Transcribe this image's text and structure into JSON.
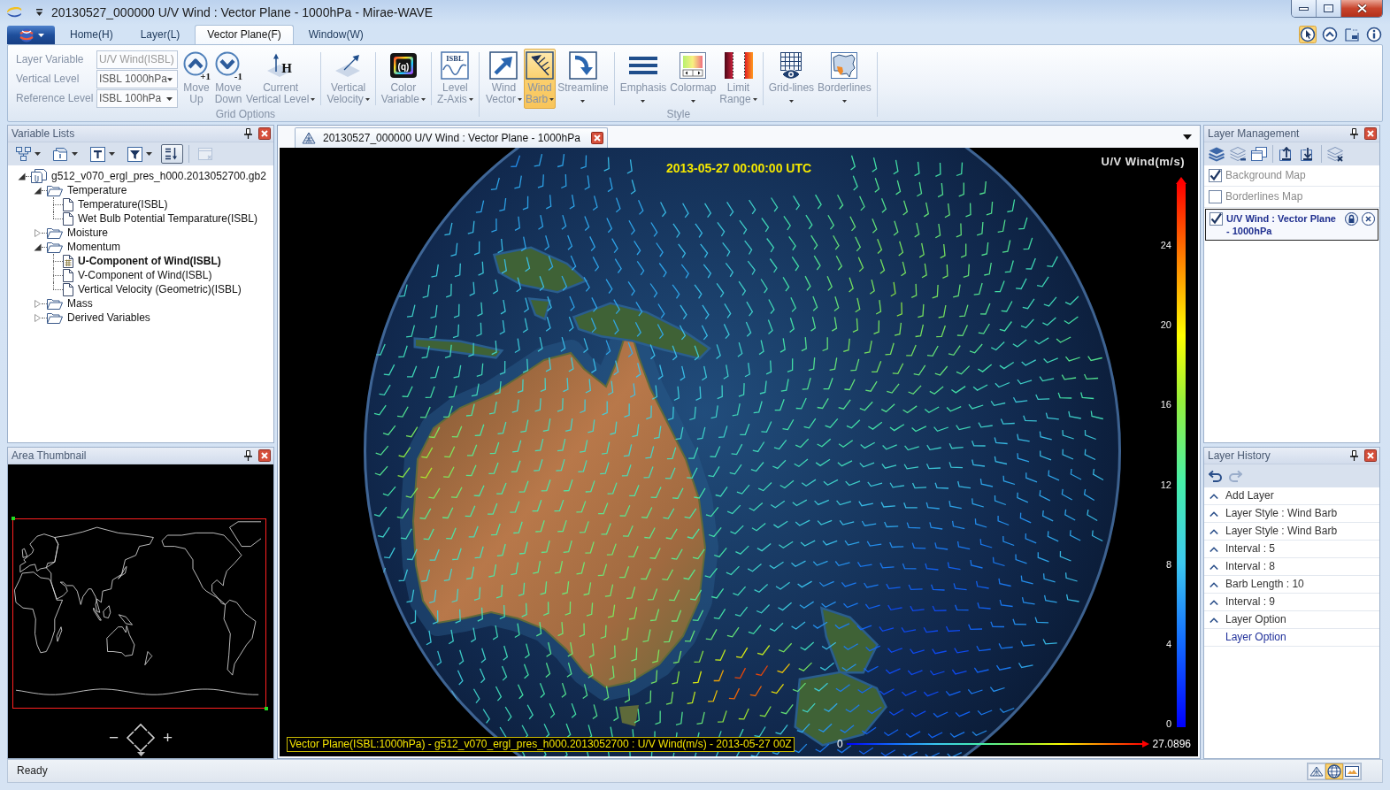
{
  "window": {
    "title": "20130527_000000 U/V Wind : Vector Plane - 1000hPa - Mirae-WAVE"
  },
  "ribbon": {
    "tabs": [
      {
        "label": "Home(H)",
        "selected": false
      },
      {
        "label": "Layer(L)",
        "selected": false
      },
      {
        "label": "Vector Plane(F)",
        "selected": true
      },
      {
        "label": "Window(W)",
        "selected": false
      }
    ],
    "quick_tools": [
      {
        "selected": true
      },
      {
        "selected": false
      },
      {
        "selected": false
      },
      {
        "selected": false
      }
    ],
    "groups": [
      {
        "label": "Grid Options",
        "fields": [
          {
            "label": "Layer Variable",
            "value": "U/V Wind(ISBL)",
            "disabled": true
          },
          {
            "label": "Vertical Level",
            "value": "ISBL 1000hPa",
            "disabled": false
          },
          {
            "label": "Reference Level",
            "value": "ISBL 100hPa",
            "disabled": false
          }
        ],
        "sections": [
          [
            {
              "label": "Move Up",
              "icon_text": "+1",
              "dropdown": false,
              "selected": false
            },
            {
              "label": "Move Down",
              "icon_text": "-1",
              "dropdown": false,
              "selected": false
            },
            {
              "label": "Current Vertical Level",
              "icon_text": "H",
              "dropdown": true,
              "selected": false
            }
          ],
          [
            {
              "label": "Vertical Velocity",
              "dropdown": true,
              "selected": false
            }
          ],
          [
            {
              "label": "Color Variable",
              "icon_text": "(q)",
              "dropdown": true,
              "selected": false
            }
          ],
          [
            {
              "label": "Level Z-Axis",
              "icon_text": "ISBL",
              "dropdown": true,
              "selected": false
            }
          ]
        ]
      },
      {
        "label": "Style",
        "sections": [
          [
            {
              "label": "Wind Vector",
              "dropdown": true,
              "selected": false
            },
            {
              "label": "Wind Barb",
              "dropdown": true,
              "selected": true
            },
            {
              "label": "Streamline",
              "dropdown": true,
              "selected": false
            }
          ],
          [
            {
              "label": "Emphasis",
              "dropdown": true,
              "selected": false
            },
            {
              "label": "Colormap",
              "dropdown": true,
              "selected": false
            },
            {
              "label": "Limit Range",
              "dropdown": true,
              "selected": false
            }
          ],
          [
            {
              "label": "Grid-lines",
              "dropdown": true,
              "selected": false
            },
            {
              "label": "Borderlines",
              "dropdown": true,
              "selected": false
            }
          ]
        ]
      }
    ]
  },
  "variable_lists": {
    "title": "Variable Lists",
    "toolbar": [
      {
        "dropdown": true,
        "selected": false,
        "disabled": false
      },
      {
        "dropdown": true,
        "selected": false,
        "disabled": false
      },
      {
        "dropdown": true,
        "selected": false,
        "disabled": false
      },
      {
        "dropdown": true,
        "selected": false,
        "disabled": false
      },
      {
        "dropdown": false,
        "selected": true,
        "disabled": false
      },
      {
        "dropdown": false,
        "selected": false,
        "disabled": true
      }
    ],
    "tree": [
      {
        "label": "g512_v070_ergl_pres_h000.2013052700.gb2",
        "kind": "file",
        "expanded": true,
        "selected": false,
        "children": [
          {
            "label": "Temperature",
            "kind": "folder",
            "expanded": true,
            "selected": false,
            "children": [
              {
                "label": "Temperature(ISBL)",
                "kind": "variable",
                "selected": false
              },
              {
                "label": "Wet Bulb Potential Temparature(ISBL)",
                "kind": "variable",
                "selected": false
              }
            ]
          },
          {
            "label": "Moisture",
            "kind": "folder",
            "expanded": false,
            "selected": false
          },
          {
            "label": "Momentum",
            "kind": "folder",
            "expanded": true,
            "selected": false,
            "children": [
              {
                "label": "U-Component of Wind(ISBL)",
                "kind": "variable",
                "selected": true
              },
              {
                "label": "V-Component of Wind(ISBL)",
                "kind": "variable",
                "selected": false
              },
              {
                "label": "Vertical Velocity (Geometric)(ISBL)",
                "kind": "variable",
                "selected": false
              }
            ]
          },
          {
            "label": "Mass",
            "kind": "folder",
            "expanded": false,
            "selected": false
          },
          {
            "label": "Derived Variables",
            "kind": "folder",
            "expanded": false,
            "selected": false
          }
        ]
      }
    ]
  },
  "area_thumbnail": {
    "title": "Area Thumbnail",
    "zoom_out": "−",
    "zoom_in": "+"
  },
  "document": {
    "tab": "20130527_000000 U/V Wind : Vector Plane - 1000hPa",
    "timestamp": "2013-05-27 00:00:00 UTC",
    "legend": {
      "title": "U/V Wind(m/s)",
      "ticks": [
        "24",
        "20",
        "16",
        "12",
        "8",
        "4",
        "0"
      ],
      "min": "0",
      "max": "27.0896"
    },
    "caption": "Vector Plane(ISBL:1000hPa) - g512_v070_ergl_pres_h000.2013052700 : U/V Wind(m/s) - 2013-05-27 00Z"
  },
  "layer_management": {
    "title": "Layer Management",
    "layers": [
      {
        "name": "Background Map",
        "checked": true,
        "selected": false
      },
      {
        "name": "Borderlines Map",
        "checked": false,
        "selected": false
      },
      {
        "name": "U/V Wind : Vector Plane - 1000hPa",
        "checked": true,
        "selected": true
      }
    ]
  },
  "layer_history": {
    "title": "Layer History",
    "toolbar": [
      {
        "disabled": false
      },
      {
        "disabled": true
      }
    ],
    "entries": [
      {
        "label": "Add Layer",
        "selected": false
      },
      {
        "label": "Layer Style : Wind Barb",
        "selected": false
      },
      {
        "label": "Layer Style : Wind Barb",
        "selected": false
      },
      {
        "label": "Interval : 5",
        "selected": false
      },
      {
        "label": "Interval : 8",
        "selected": false
      },
      {
        "label": "Barb Length : 10",
        "selected": false
      },
      {
        "label": "Interval : 9",
        "selected": false
      },
      {
        "label": "Layer Option",
        "selected": false
      },
      {
        "label": "Layer Option",
        "selected": true
      }
    ]
  },
  "status_bar": {
    "text": "Ready",
    "views": [
      {
        "selected": false
      },
      {
        "selected": true
      },
      {
        "selected": false
      }
    ]
  }
}
